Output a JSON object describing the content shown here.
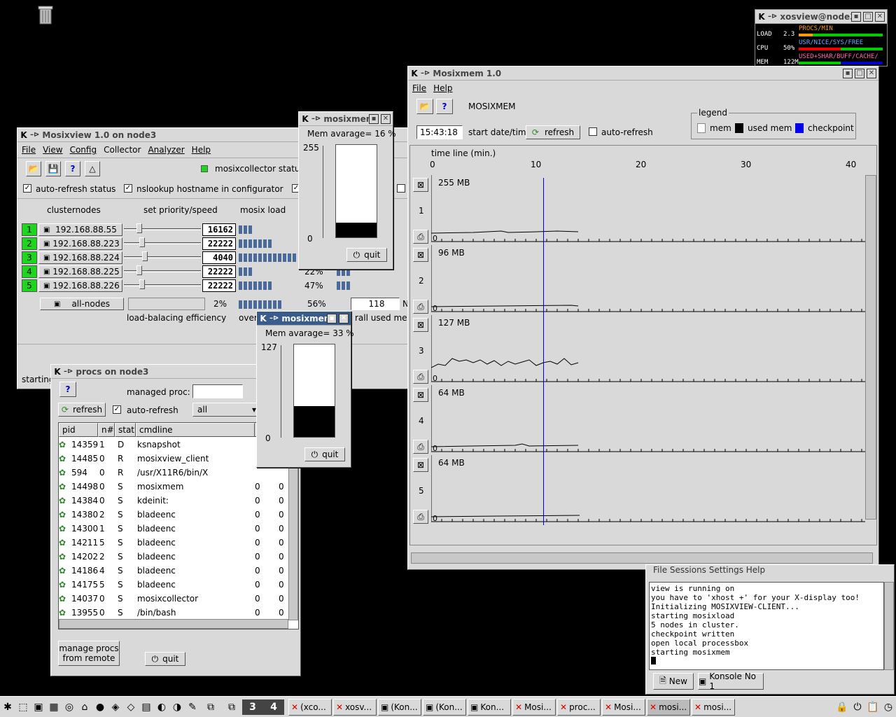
{
  "desktop": {
    "trash_icon": "trash-icon"
  },
  "mosixview": {
    "title": "Mosixview 1.0  on node3",
    "menu": [
      "File",
      "View",
      "Config",
      "Collector",
      "Analyzer",
      "Help"
    ],
    "collector_status": "mosixcollector status",
    "auto_refresh": "auto-refresh status",
    "nslookup": "nslookup hostname in configurator",
    "col_nodes": "clusternodes",
    "col_priority": "set priority/speed",
    "col_load": "mosix load",
    "nodes": [
      {
        "id": "1",
        "ip": "192.168.88.55",
        "speed": "16162",
        "load_bars": 3,
        "pct": "",
        "bars2": 0
      },
      {
        "id": "2",
        "ip": "192.168.88.223",
        "speed": "22222",
        "load_bars": 7,
        "pct": "",
        "bars2": 0
      },
      {
        "id": "3",
        "ip": "192.168.88.224",
        "speed": "4040",
        "load_bars": 12,
        "pct": "",
        "bars2": 0
      },
      {
        "id": "4",
        "ip": "192.168.88.225",
        "speed": "22222",
        "load_bars": 3,
        "pct": "22%",
        "bars2": 3
      },
      {
        "id": "5",
        "ip": "192.168.88.226",
        "speed": "22222",
        "load_bars": 7,
        "pct": "47%",
        "bars2": 3
      }
    ],
    "all_nodes": "all-nodes",
    "all_pct": "2%",
    "all_pct2": "56%",
    "all_used": "118",
    "all_n": "N",
    "lb_eff": "load-balacing efficiency",
    "over": "over",
    "overall_used": "rall used mem.",
    "status": "starting"
  },
  "mem1": {
    "title": "mosixmem",
    "avg": "Mem avarage= 16 %",
    "max": "255",
    "min": "0",
    "fill": 0.16,
    "quit": "quit"
  },
  "mem2": {
    "title": "mosixmem",
    "avg": "Mem avarage= 33 %",
    "max": "127",
    "min": "0",
    "fill": 0.33,
    "quit": "quit"
  },
  "procs": {
    "title": "procs on node3",
    "managed": "managed proc:",
    "refresh": "refresh",
    "auto_refresh": "auto-refresh",
    "filter": "all",
    "headers": [
      "pid",
      "n#",
      "stat",
      "cmdline"
    ],
    "rows": [
      {
        "pid": "14359",
        "n": "1",
        "stat": "D",
        "cmd": "ksnapshot",
        "a": "",
        "b": ""
      },
      {
        "pid": "14485",
        "n": "0",
        "stat": "R",
        "cmd": "mosixview_client",
        "a": "",
        "b": ""
      },
      {
        "pid": "594",
        "n": "0",
        "stat": "R",
        "cmd": "/usr/X11R6/bin/X",
        "a": "",
        "b": ""
      },
      {
        "pid": "14498",
        "n": "0",
        "stat": "S",
        "cmd": "mosixmem",
        "a": "0",
        "b": "0"
      },
      {
        "pid": "14384",
        "n": "0",
        "stat": "S",
        "cmd": "kdeinit:",
        "a": "0",
        "b": "0"
      },
      {
        "pid": "14380",
        "n": "2",
        "stat": "S",
        "cmd": "bladeenc",
        "a": "0",
        "b": "0"
      },
      {
        "pid": "14300",
        "n": "1",
        "stat": "S",
        "cmd": "bladeenc",
        "a": "0",
        "b": "0"
      },
      {
        "pid": "14211",
        "n": "5",
        "stat": "S",
        "cmd": "bladeenc",
        "a": "0",
        "b": "0"
      },
      {
        "pid": "14202",
        "n": "2",
        "stat": "S",
        "cmd": "bladeenc",
        "a": "0",
        "b": "0"
      },
      {
        "pid": "14186",
        "n": "4",
        "stat": "S",
        "cmd": "bladeenc",
        "a": "0",
        "b": "0"
      },
      {
        "pid": "14175",
        "n": "5",
        "stat": "S",
        "cmd": "bladeenc",
        "a": "0",
        "b": "0"
      },
      {
        "pid": "14037",
        "n": "0",
        "stat": "S",
        "cmd": "mosixcollector",
        "a": "0",
        "b": "0"
      },
      {
        "pid": "13955",
        "n": "0",
        "stat": "S",
        "cmd": "/bin/bash",
        "a": "0",
        "b": "0"
      }
    ],
    "manage_remote": [
      "manage procs",
      "from remote"
    ],
    "quit": "quit"
  },
  "mosixmemwin": {
    "title": "Mosixmem 1.0",
    "menu": [
      "File",
      "Help"
    ],
    "label": "MOSIXMEM",
    "time": "15:43:18",
    "start_date": "start date/time",
    "refresh": "refresh",
    "auto_refresh": "auto-refresh",
    "legend_title": "legend",
    "legend": [
      {
        "label": "mem",
        "color": "#ffffff"
      },
      {
        "label": "used mem",
        "color": "#000000"
      },
      {
        "label": "checkpoint",
        "color": "#0000ee"
      }
    ],
    "timeline": "time line (min.)",
    "ticks": [
      "0",
      "10",
      "20",
      "30",
      "40"
    ],
    "rows": [
      {
        "id": "1",
        "max": "255 MB",
        "zero": "0"
      },
      {
        "id": "2",
        "max": "96 MB",
        "zero": "0"
      },
      {
        "id": "3",
        "max": "127 MB",
        "zero": "0"
      },
      {
        "id": "4",
        "max": "64 MB",
        "zero": "0"
      },
      {
        "id": "5",
        "max": "64 MB",
        "zero": "0"
      }
    ]
  },
  "xosview": {
    "title": "xosview@node3",
    "rows": [
      {
        "label": "LOAD",
        "val": "2.3",
        "legend": "PROCS/MIN"
      },
      {
        "label": "CPU",
        "val": "50%",
        "legend": "USR/NICE/SYS/FREE"
      },
      {
        "label": "MEM",
        "val": "122M",
        "legend": "USED+SHAR/BUFF/CACHE/"
      }
    ]
  },
  "konsole": {
    "menu": "File  Sessions  Settings  Help",
    "lines": [
      "view is running on",
      "you have to 'xhost +' for your X-display too!",
      "Initializing MOSIXVIEW-CLIENT...",
      "starting mosixload",
      "5 nodes in cluster.",
      "checkpoint written",
      "open local processbox",
      "starting mosixmem"
    ],
    "tab_new": "New",
    "tab_konsole": "Konsole No 1"
  },
  "taskbar": {
    "desk3": "3",
    "desk4": "4",
    "tasks": [
      "(xco...",
      "xosv...",
      "(Kon...",
      "(Kon...",
      "Kon...",
      "Mosi...",
      "proc...",
      "Mosi...",
      "mosi...",
      "mosi..."
    ]
  }
}
